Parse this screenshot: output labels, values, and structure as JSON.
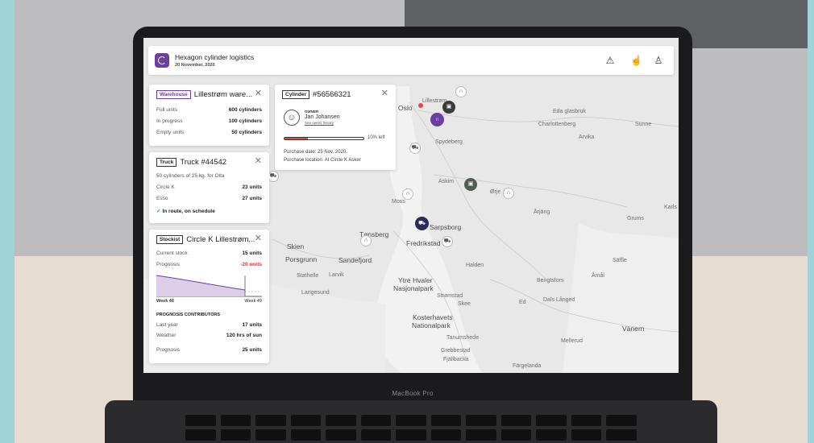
{
  "header": {
    "app_title": "Hexagon cylinder logistics",
    "date": "20 November, 2020",
    "icons": [
      "warning-icon",
      "hand-icon",
      "user-icon"
    ]
  },
  "warehouse_card": {
    "tag": "Warehouse",
    "title": "Lillestrøm ware...",
    "rows": [
      {
        "label": "Full units",
        "value": "600 cylinders"
      },
      {
        "label": "In progress",
        "value": "100 cylinders"
      },
      {
        "label": "Empty units",
        "value": "50 cylinders"
      }
    ]
  },
  "truck_card": {
    "tag": "Truck",
    "title": "Truck #44542",
    "subtitle": "50 cylinders of 25 kg. for Olta",
    "rows": [
      {
        "label": "Circle K",
        "value": "23 units"
      },
      {
        "label": "Esso",
        "value": "27 units"
      }
    ],
    "status": "In route, on schedule"
  },
  "stockist_card": {
    "tag": "Stockist",
    "title": "Circle K Lillestrøm...",
    "rows": [
      {
        "label": "Current stock",
        "value": "15 units"
      },
      {
        "label": "Prognosis",
        "value": "-20 units"
      }
    ],
    "chart_start": "Week 46",
    "chart_end": "Week 49",
    "contributors_heading": "PROGNOSIS CONTRIBUTORS",
    "contributors": [
      {
        "label": "Last year",
        "value": "17 units"
      },
      {
        "label": "Weather",
        "value": "120 hrs of sun"
      }
    ],
    "total": {
      "label": "Prognosis",
      "value": "25 units"
    }
  },
  "cylinder_card": {
    "tag": "Cylinder",
    "title": "#56566321",
    "owner_label": "OWNER",
    "owner_name": "Jan Johansen",
    "owner_link": "See owner history",
    "fill_percent": 10,
    "fill_text": "10% left",
    "purchase_date": "Purchase date: 25 Nov, 2020.",
    "purchase_location": "Purchase location: At Circle K Asker"
  },
  "map_labels": [
    "Oslo",
    "Lillestrøm",
    "Eda glasbruk",
    "Charlottenberg",
    "Sunne",
    "Arvika",
    "Spydeberg",
    "Askim",
    "Ørje",
    "Moss",
    "Sarpsborg",
    "Fredrikstad",
    "Tønsberg",
    "Skien",
    "Porsgrunn",
    "Sandefjord",
    "Larvik",
    "Stathelle",
    "Langesund",
    "Halden",
    "Ytre Hvaler",
    "Nasjonalpark",
    "Strømstad",
    "Skee",
    "Kosterhavets",
    "Nationalpark",
    "Tanumshede",
    "Grebbestad",
    "Fjällbacka",
    "Bengtsfors",
    "Åmål",
    "Dals Långed",
    "Ed",
    "Årjäng",
    "Säffle",
    "Vänern",
    "Mellerud",
    "Färgelanda",
    "Grums",
    "Karls"
  ],
  "device_label": "MacBook Pro",
  "colors": {
    "brand": "#6b3fa0",
    "alert": "#e8453c",
    "ok": "#2d9a6b"
  }
}
